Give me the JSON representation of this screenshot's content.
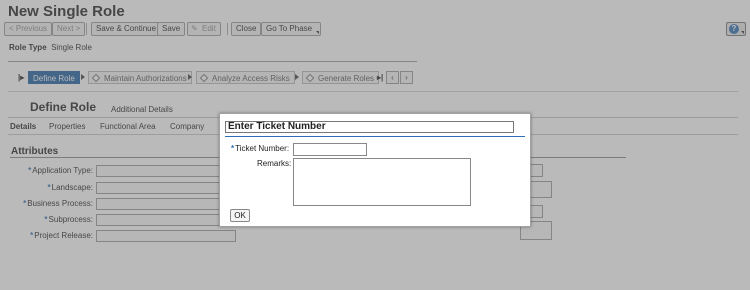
{
  "page": {
    "title": "New Single Role",
    "toolbar": {
      "previous": "< Previous",
      "next": "Next >",
      "save_continue": "Save & Continue",
      "save": "Save",
      "edit": "Edit",
      "close": "Close",
      "goto_phase": "Go To Phase",
      "help": "?"
    },
    "role_type_label": "Role Type",
    "role_type_value": "Single Role",
    "phases": [
      {
        "label": "Define Role",
        "active": true
      },
      {
        "label": "Maintain Authorizations",
        "active": false
      },
      {
        "label": "Analyze Access Risks",
        "active": false
      },
      {
        "label": "Generate Roles",
        "active": false
      }
    ],
    "tabs": {
      "main": "Define Role",
      "additional": "Additional Details"
    },
    "subtabs": [
      "Details",
      "Properties",
      "Functional Area",
      "Company"
    ],
    "section_title": "Attributes",
    "fields": [
      {
        "label": "Application Type:",
        "required": true
      },
      {
        "label": "Landscape:",
        "required": true
      },
      {
        "label": "Business Process:",
        "required": true
      },
      {
        "label": "Subprocess:",
        "required": true
      },
      {
        "label": "Project Release:",
        "required": true
      }
    ]
  },
  "dialog": {
    "title": "Enter Ticket Number",
    "ticket_label": "Ticket Number:",
    "ticket_value": "",
    "remarks_label": "Remarks:",
    "remarks_value": "",
    "ok": "OK"
  },
  "colors": {
    "accent": "#1d5f9f",
    "required_marker": "#2e6db5",
    "overlay": "#6e6e6e"
  }
}
